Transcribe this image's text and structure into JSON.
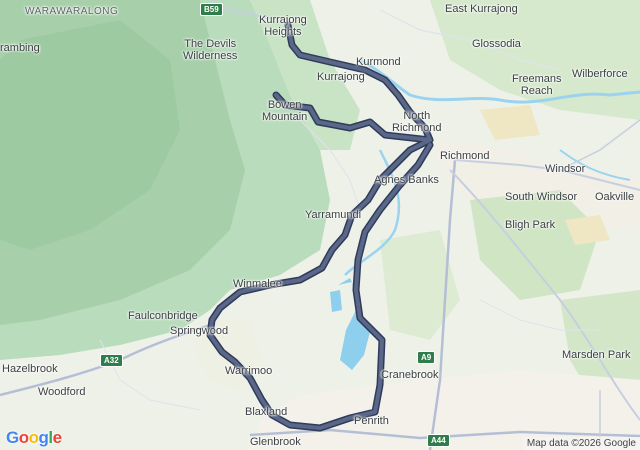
{
  "places": [
    {
      "id": "warawaralong",
      "label": "WARAWARALONG",
      "style": "caps"
    },
    {
      "id": "kurrajong-heights",
      "label": "Kurrajong\nHeights",
      "style": "normal"
    },
    {
      "id": "east-kurrajong",
      "label": "East Kurrajong",
      "style": "normal"
    },
    {
      "id": "bilpin-rambing",
      "label": "rambing",
      "style": "normal"
    },
    {
      "id": "devils-wilderness",
      "label": "The Devils\nWilderness",
      "style": "normal"
    },
    {
      "id": "glossodia",
      "label": "Glossodia",
      "style": "normal"
    },
    {
      "id": "kurmond",
      "label": "Kurmond",
      "style": "normal"
    },
    {
      "id": "kurrajong",
      "label": "Kurrajong",
      "style": "normal"
    },
    {
      "id": "freemans-reach",
      "label": "Freemans\nReach",
      "style": "normal"
    },
    {
      "id": "wilberforce",
      "label": "Wilberforce",
      "style": "normal"
    },
    {
      "id": "bowen-mountain",
      "label": "Bowen\nMountain",
      "style": "normal"
    },
    {
      "id": "north-richmond",
      "label": "North\nRichmond",
      "style": "normal"
    },
    {
      "id": "richmond",
      "label": "Richmond",
      "style": "normal"
    },
    {
      "id": "windsor",
      "label": "Windsor",
      "style": "normal"
    },
    {
      "id": "agnes-banks",
      "label": "Agnes Banks",
      "style": "normal"
    },
    {
      "id": "south-windsor",
      "label": "South Windsor",
      "style": "normal"
    },
    {
      "id": "oakville",
      "label": "Oakville",
      "style": "normal"
    },
    {
      "id": "yarramundi",
      "label": "Yarramundi",
      "style": "normal"
    },
    {
      "id": "bligh-park",
      "label": "Bligh Park",
      "style": "normal"
    },
    {
      "id": "winmalee",
      "label": "Winmalee",
      "style": "normal"
    },
    {
      "id": "faulconbridge",
      "label": "Faulconbridge",
      "style": "normal"
    },
    {
      "id": "springwood",
      "label": "Springwood",
      "style": "normal"
    },
    {
      "id": "marsden-park",
      "label": "Marsden Park",
      "style": "normal"
    },
    {
      "id": "hazelbrook",
      "label": "Hazelbrook",
      "style": "normal"
    },
    {
      "id": "warrimoo",
      "label": "Warrimoo",
      "style": "normal"
    },
    {
      "id": "cranebrook",
      "label": "Cranebrook",
      "style": "normal"
    },
    {
      "id": "woodford",
      "label": "Woodford",
      "style": "normal"
    },
    {
      "id": "blaxland",
      "label": "Blaxland",
      "style": "normal"
    },
    {
      "id": "penrith",
      "label": "Penrith",
      "style": "normal"
    },
    {
      "id": "glenbrook",
      "label": "Glenbrook",
      "style": "normal"
    }
  ],
  "road_shields": [
    {
      "id": "b59",
      "label": "B59"
    },
    {
      "id": "a32",
      "label": "A32"
    },
    {
      "id": "a9",
      "label": "A9"
    },
    {
      "id": "a44",
      "label": "A44"
    }
  ],
  "logo": {
    "g1": "G",
    "o1": "o",
    "o2": "o",
    "g2": "g",
    "l": "l",
    "e": "e"
  },
  "attribution": "Map data ©2026 Google",
  "colors": {
    "route": "#5a6786",
    "route_outline": "#2f3b5c",
    "water": "#9ad3f0",
    "forest": "#a9d3ad",
    "urban": "#f1efe6",
    "highway": "#9aa7c7"
  }
}
